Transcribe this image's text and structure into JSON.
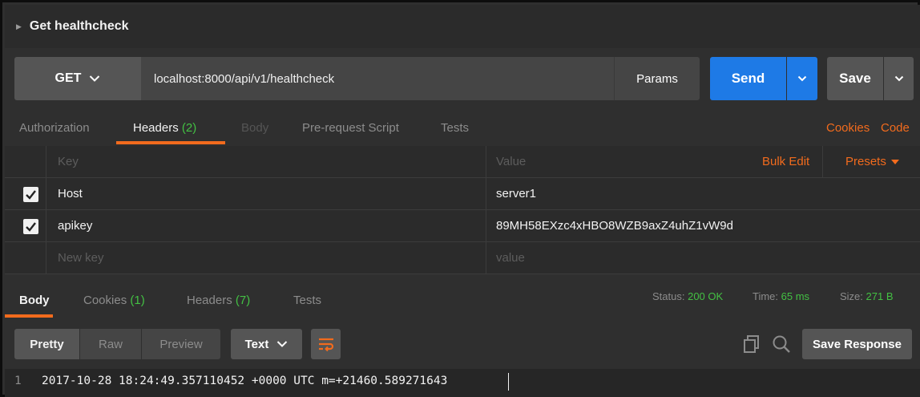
{
  "request": {
    "title": "Get healthcheck",
    "method": "GET",
    "url": "localhost:8000/api/v1/healthcheck",
    "params_label": "Params",
    "send_label": "Send",
    "save_label": "Save"
  },
  "request_tabs": {
    "authorization": "Authorization",
    "headers": "Headers",
    "headers_count": "(2)",
    "body": "Body",
    "prerequest": "Pre-request Script",
    "tests": "Tests",
    "cookies": "Cookies",
    "code": "Code"
  },
  "headers_table": {
    "key_header": "Key",
    "value_header": "Value",
    "bulk_edit": "Bulk Edit",
    "presets": "Presets",
    "rows": [
      {
        "key": "Host",
        "value": "server1",
        "checked": true
      },
      {
        "key": "apikey",
        "value": "89MH58EXzc4xHBO8WZB9axZ4uhZ1vW9d",
        "checked": true
      }
    ],
    "new_key_placeholder": "New key",
    "new_value_placeholder": "value"
  },
  "response_tabs": {
    "body": "Body",
    "cookies": "Cookies",
    "cookies_count": "(1)",
    "headers": "Headers",
    "headers_count": "(7)",
    "tests": "Tests"
  },
  "response_status": {
    "status_label": "Status:",
    "status_value": "200 OK",
    "time_label": "Time:",
    "time_value": "65 ms",
    "size_label": "Size:",
    "size_value": "271 B"
  },
  "response_toolbar": {
    "pretty": "Pretty",
    "raw": "Raw",
    "preview": "Preview",
    "format": "Text",
    "save_response": "Save Response"
  },
  "response_body": {
    "line_number": "1",
    "line_text": "2017-10-28 18:24:49.357110452 +0000 UTC m=+21460.589271643"
  },
  "colors": {
    "accent_orange": "#f26b1d",
    "send_blue": "#1e7ae6",
    "count_green": "#43c043"
  }
}
